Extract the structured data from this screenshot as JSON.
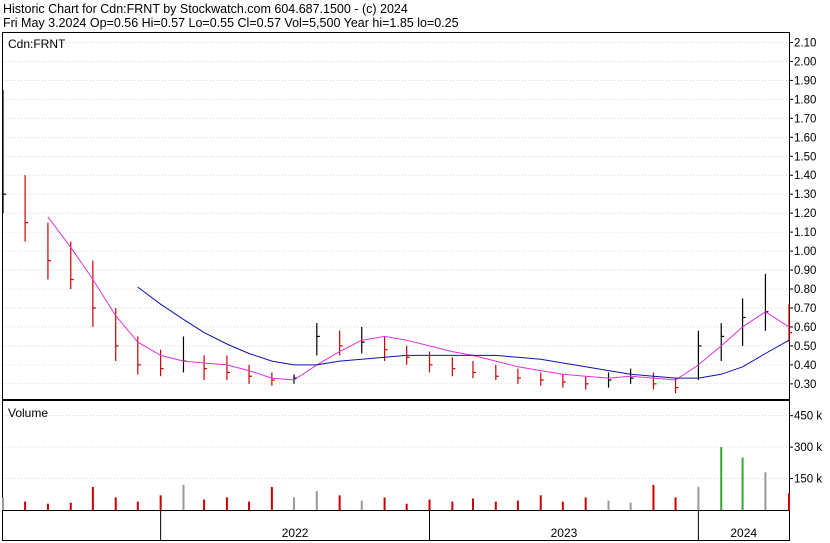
{
  "header": {
    "line1": "Historic Chart for Cdn:FRNT by Stockwatch.com 604.687.1500 - (c) 2024",
    "line2": "Fri May  3.2024   Op=0.56  Hi=0.57  Lo=0.55  Cl=0.57  Vol=5,500  Year hi=1.85  lo=0.25"
  },
  "price_panel": {
    "label": "Cdn:FRNT"
  },
  "volume_panel": {
    "label": "Volume"
  },
  "colors": {
    "up": "#000000",
    "down": "#cc0000",
    "ma_short": "#dd33dd",
    "ma_long": "#1111aa",
    "vol_green": "#33aa33",
    "vol_red": "#cc0000",
    "vol_gray": "#999999",
    "grid": "#bbbbbb"
  },
  "chart_data": [
    {
      "type": "line",
      "title": "Cdn:FRNT",
      "y_tick_labels": [
        "2.10",
        "2.00",
        "1.90",
        "1.80",
        "1.70",
        "1.60",
        "1.50",
        "1.40",
        "1.30",
        "1.20",
        "1.10",
        "1.00",
        "0.90",
        "0.80",
        "0.70",
        "0.60",
        "0.50",
        "0.40",
        "0.30"
      ],
      "ylim": [
        0.22,
        2.15
      ],
      "x_labels": [
        "2022",
        "2023",
        "2024"
      ],
      "x_label_dates": [
        "2022-01-01",
        "2023-01-01",
        "2024-01-01"
      ],
      "x_range": [
        "2021-06-01",
        "2024-05-03"
      ],
      "grid": true,
      "price_range": {
        "x": [
          "2021-06-01",
          "2021-07-01",
          "2021-08-01",
          "2021-09-01",
          "2021-10-01",
          "2021-11-01",
          "2021-12-01",
          "2022-01-01",
          "2022-02-01",
          "2022-03-01",
          "2022-04-01",
          "2022-05-01",
          "2022-06-01",
          "2022-07-01",
          "2022-08-01",
          "2022-09-01",
          "2022-10-01",
          "2022-11-01",
          "2022-12-01",
          "2023-01-01",
          "2023-02-01",
          "2023-03-01",
          "2023-04-01",
          "2023-05-01",
          "2023-06-01",
          "2023-07-01",
          "2023-08-01",
          "2023-09-01",
          "2023-10-01",
          "2023-11-01",
          "2023-12-01",
          "2024-01-01",
          "2024-02-01",
          "2024-03-01",
          "2024-04-01",
          "2024-05-03"
        ],
        "high": [
          1.85,
          1.4,
          1.15,
          1.05,
          0.95,
          0.7,
          0.55,
          0.48,
          0.55,
          0.45,
          0.45,
          0.4,
          0.36,
          0.35,
          0.62,
          0.58,
          0.6,
          0.55,
          0.5,
          0.47,
          0.44,
          0.42,
          0.4,
          0.38,
          0.36,
          0.35,
          0.34,
          0.36,
          0.38,
          0.36,
          0.33,
          0.58,
          0.62,
          0.75,
          0.88,
          0.72
        ],
        "low": [
          1.2,
          1.05,
          0.85,
          0.8,
          0.6,
          0.42,
          0.35,
          0.34,
          0.36,
          0.32,
          0.32,
          0.3,
          0.29,
          0.3,
          0.45,
          0.45,
          0.46,
          0.42,
          0.4,
          0.36,
          0.34,
          0.33,
          0.32,
          0.3,
          0.29,
          0.28,
          0.27,
          0.28,
          0.3,
          0.27,
          0.25,
          0.32,
          0.42,
          0.5,
          0.58,
          0.52
        ],
        "close": [
          1.3,
          1.15,
          0.95,
          0.85,
          0.7,
          0.5,
          0.4,
          0.38,
          0.42,
          0.38,
          0.36,
          0.34,
          0.32,
          0.33,
          0.55,
          0.5,
          0.52,
          0.48,
          0.44,
          0.4,
          0.38,
          0.36,
          0.34,
          0.33,
          0.32,
          0.31,
          0.3,
          0.32,
          0.33,
          0.3,
          0.28,
          0.5,
          0.55,
          0.65,
          0.68,
          0.57
        ]
      },
      "series": [
        {
          "name": "",
          "x": [
            "2021-08-01",
            "2021-09-01",
            "2021-10-01",
            "2021-11-01",
            "2021-12-01",
            "2022-01-01",
            "2022-02-01",
            "2022-03-01",
            "2022-04-01",
            "2022-05-01",
            "2022-06-01",
            "2022-07-01",
            "2022-08-01",
            "2022-09-01",
            "2022-10-01",
            "2022-11-01",
            "2022-12-01",
            "2023-01-01",
            "2023-02-01",
            "2023-03-01",
            "2023-04-01",
            "2023-05-01",
            "2023-06-01",
            "2023-07-01",
            "2023-08-01",
            "2023-09-01",
            "2023-10-01",
            "2023-11-01",
            "2023-12-01",
            "2024-01-01",
            "2024-02-01",
            "2024-03-01",
            "2024-04-01",
            "2024-05-03"
          ],
          "values": [
            1.18,
            1.02,
            0.85,
            0.66,
            0.52,
            0.45,
            0.42,
            0.41,
            0.4,
            0.37,
            0.33,
            0.32,
            0.4,
            0.47,
            0.53,
            0.55,
            0.53,
            0.5,
            0.47,
            0.45,
            0.42,
            0.39,
            0.37,
            0.35,
            0.34,
            0.33,
            0.34,
            0.33,
            0.32,
            0.4,
            0.5,
            0.6,
            0.68,
            0.6
          ]
        },
        {
          "name": "",
          "x": [
            "2021-12-01",
            "2022-01-01",
            "2022-02-01",
            "2022-03-01",
            "2022-04-01",
            "2022-05-01",
            "2022-06-01",
            "2022-07-01",
            "2022-08-01",
            "2022-09-01",
            "2022-10-01",
            "2022-11-01",
            "2022-12-01",
            "2023-01-01",
            "2023-02-01",
            "2023-03-01",
            "2023-04-01",
            "2023-05-01",
            "2023-06-01",
            "2023-07-01",
            "2023-08-01",
            "2023-09-01",
            "2023-10-01",
            "2023-11-01",
            "2023-12-01",
            "2024-01-01",
            "2024-02-01",
            "2024-03-01",
            "2024-04-01",
            "2024-05-03"
          ],
          "values": [
            0.81,
            0.72,
            0.64,
            0.57,
            0.51,
            0.46,
            0.42,
            0.4,
            0.4,
            0.42,
            0.43,
            0.44,
            0.45,
            0.45,
            0.45,
            0.45,
            0.45,
            0.44,
            0.43,
            0.41,
            0.39,
            0.37,
            0.35,
            0.34,
            0.33,
            0.33,
            0.35,
            0.39,
            0.46,
            0.53
          ]
        }
      ]
    },
    {
      "type": "bar",
      "title": "Volume",
      "y_tick_labels": [
        "450 k",
        "300 k",
        "150 k"
      ],
      "ylim": [
        0,
        520
      ],
      "unit": "k",
      "x": [
        "2021-06-01",
        "2021-07-01",
        "2021-08-01",
        "2021-09-01",
        "2021-10-01",
        "2021-11-01",
        "2021-12-01",
        "2022-01-01",
        "2022-02-01",
        "2022-03-01",
        "2022-04-01",
        "2022-05-01",
        "2022-06-01",
        "2022-07-01",
        "2022-08-01",
        "2022-09-01",
        "2022-10-01",
        "2022-11-01",
        "2022-12-01",
        "2023-01-01",
        "2023-02-01",
        "2023-03-01",
        "2023-04-01",
        "2023-05-01",
        "2023-06-01",
        "2023-07-01",
        "2023-08-01",
        "2023-09-01",
        "2023-10-01",
        "2023-11-01",
        "2023-12-01",
        "2024-01-01",
        "2024-02-01",
        "2024-03-01",
        "2024-04-01",
        "2024-05-03"
      ],
      "values": [
        60,
        40,
        30,
        35,
        110,
        60,
        40,
        70,
        120,
        50,
        60,
        40,
        110,
        60,
        90,
        70,
        45,
        60,
        30,
        50,
        40,
        55,
        40,
        45,
        70,
        40,
        60,
        45,
        35,
        120,
        60,
        110,
        300,
        250,
        180,
        80
      ]
    }
  ]
}
